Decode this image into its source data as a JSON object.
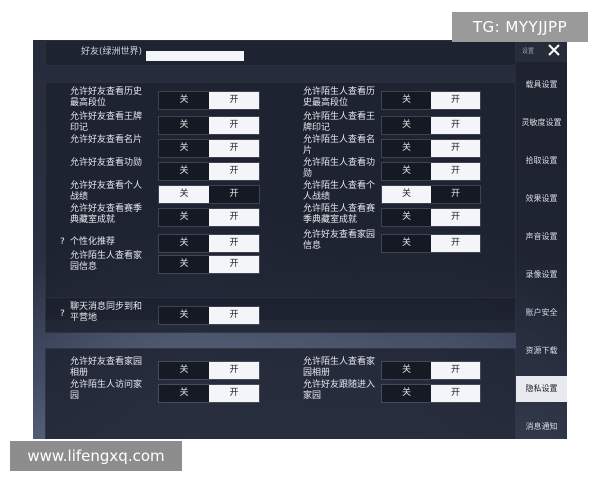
{
  "watermarks": {
    "top": "TG: MYYJJPP",
    "bottom": "www.lifengxq.com"
  },
  "toggle": {
    "off": "关",
    "on": "开"
  },
  "top_section": {
    "label": "好友(绿洲世界)"
  },
  "left_rows": [
    {
      "label": "允许好友查看历史最高段位",
      "state": "on"
    },
    {
      "label": "允许好友查看王牌印记",
      "state": "on"
    },
    {
      "label": "允许好友查看名片",
      "state": "on"
    },
    {
      "label": "允许好友查看功勋",
      "state": "on"
    },
    {
      "label": "允许好友查看个人战绩",
      "state": "off"
    },
    {
      "label": "允许好友查看赛季典藏室成就",
      "state": "on"
    },
    {
      "label": "个性化推荐",
      "state": "on",
      "help": "?"
    },
    {
      "label": "允许陌生人查看家园信息",
      "state": "on"
    }
  ],
  "right_rows": [
    {
      "label": "允许陌生人查看历史最高段位",
      "state": "on"
    },
    {
      "label": "允许陌生人查看王牌印记",
      "state": "on"
    },
    {
      "label": "允许陌生人查看名片",
      "state": "on"
    },
    {
      "label": "允许陌生人查看功勋",
      "state": "on"
    },
    {
      "label": "允许陌生人查看个人战绩",
      "state": "off"
    },
    {
      "label": "允许陌生人查看赛季典藏室成就",
      "state": "on"
    },
    {
      "label": "允许好友查看家园信息",
      "state": "on"
    }
  ],
  "chat_row": {
    "label": "聊天消息同步到和平营地",
    "state": "on",
    "help": "?"
  },
  "bottom_left_rows": [
    {
      "label": "允许好友查看家园相册",
      "state": "on"
    },
    {
      "label": "允许陌生人访问家园",
      "state": "on"
    }
  ],
  "bottom_right_rows": [
    {
      "label": "允许陌生人查看家园相册",
      "state": "on"
    },
    {
      "label": "允许好友跟随进入家园",
      "state": "on"
    }
  ],
  "sidebar": {
    "close_label": "设置",
    "items": [
      {
        "label": "载具设置"
      },
      {
        "label": "灵敏度设置"
      },
      {
        "label": "拾取设置"
      },
      {
        "label": "效果设置"
      },
      {
        "label": "声音设置"
      },
      {
        "label": "录像设置"
      },
      {
        "label": "账户安全"
      },
      {
        "label": "资源下载"
      },
      {
        "label": "隐私设置",
        "active": true
      },
      {
        "label": "消息通知"
      }
    ]
  }
}
